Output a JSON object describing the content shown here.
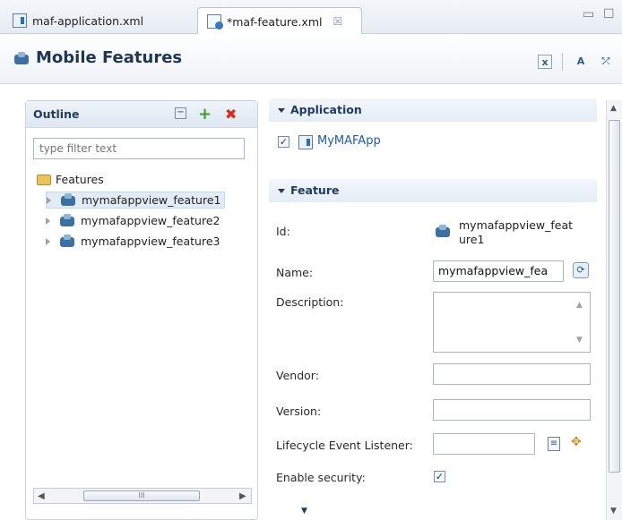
{
  "tabs": [
    {
      "label": "maf-application.xml",
      "active": false
    },
    {
      "label": "*maf-feature.xml",
      "active": true,
      "close": "☒"
    }
  ],
  "window_controls": {
    "minimize": "▭",
    "maximize": "☐"
  },
  "header": {
    "title": "Mobile Features",
    "toolbar": [
      "x",
      "A",
      "⤱"
    ]
  },
  "outline": {
    "title": "Outline",
    "filter_placeholder": "type filter text",
    "root_label": "Features",
    "items": [
      {
        "label": "mymafappview_feature1",
        "selected": true
      },
      {
        "label": "mymafappview_feature2",
        "selected": false
      },
      {
        "label": "mymafappview_feature3",
        "selected": false
      }
    ],
    "scroll_grip": "III"
  },
  "application": {
    "section_title": "Application",
    "app_name": "MyMAFApp",
    "checked": true
  },
  "feature": {
    "section_title": "Feature",
    "id_label": "Id:",
    "id_value_line1": "mymafappview_feat",
    "id_value_line2": "ure1",
    "name_label": "Name:",
    "name_value": "mymafappview_fea",
    "description_label": "Description:",
    "description_value": "",
    "vendor_label": "Vendor:",
    "vendor_value": "",
    "version_label": "Version:",
    "version_value": "",
    "lifecycle_label": "Lifecycle Event Listener:",
    "lifecycle_value": "",
    "security_label": "Enable security:",
    "security_checked": true
  },
  "colors": {
    "accent": "#2359a8",
    "header_text": "#1f3652",
    "remove_red": "#d62d20",
    "add_green": "#3e9b2e"
  }
}
